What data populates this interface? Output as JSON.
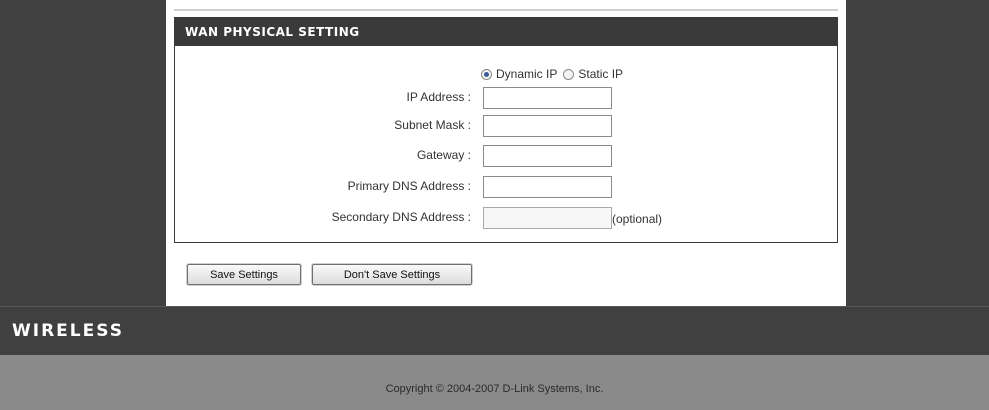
{
  "panel": {
    "title": "WAN PHYSICAL SETTING",
    "ip_mode": {
      "options": [
        {
          "label": "Dynamic IP",
          "selected": true
        },
        {
          "label": "Static IP",
          "selected": false
        }
      ]
    },
    "fields": [
      {
        "label": "IP Address :",
        "value": "",
        "enabled": true
      },
      {
        "label": "Subnet Mask :",
        "value": "",
        "enabled": true
      },
      {
        "label": "Gateway :",
        "value": "",
        "enabled": true
      },
      {
        "label": "Primary DNS Address :",
        "value": "",
        "enabled": true
      },
      {
        "label": "Secondary DNS Address :",
        "value": "",
        "enabled": false,
        "hint": "(optional)"
      }
    ]
  },
  "buttons": {
    "save_label": "Save Settings",
    "dont_save_label": "Don't Save Settings"
  },
  "brand": {
    "wireless_label": "WIRELESS"
  },
  "footer": {
    "copyright": "Copyright © 2004-2007 D-Link Systems, Inc."
  },
  "colors": {
    "header_bg": "#3a3a3a",
    "page_bg": "#404040",
    "footer_bg": "#8a8a8a",
    "radio_dot": "#3b5b9a"
  }
}
